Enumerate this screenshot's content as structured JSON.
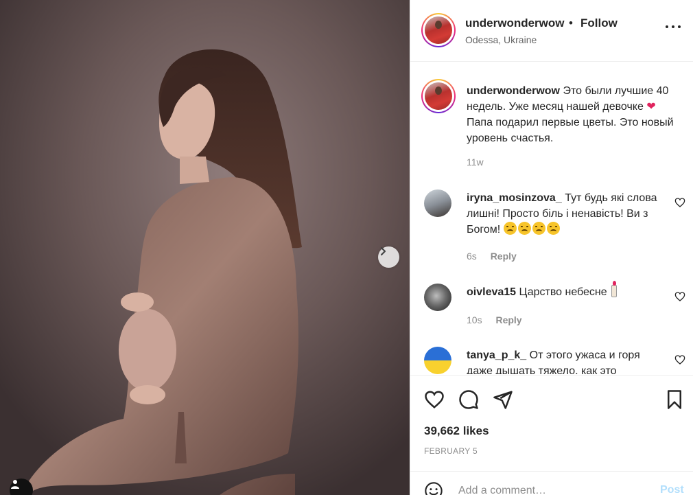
{
  "post": {
    "username": "underwonderwow",
    "separator": "•",
    "follow_label": "Follow",
    "location": "Odessa, Ukraine",
    "caption_line": "Это были лучшие 40 недель. Уже месяц нашей девочке",
    "caption_line2": "Папа подарил первые цветы. Это новый уровень счастья.",
    "caption_time": "11w",
    "likes": "39,662 likes",
    "date": "FEBRUARY 5"
  },
  "comments": [
    {
      "username": "iryna_mosinzova_",
      "text": "Тут будь які слова лишні! Просто біль і ненавість! Ви з Богом!",
      "time": "6s",
      "reply_label": "Reply"
    },
    {
      "username": "oivleva15",
      "text": "Царство небесне",
      "time": "10s",
      "reply_label": "Reply"
    },
    {
      "username": "tanya_p_k_",
      "text": "От этого ужаса и горя даже дышать тяжело, как это"
    }
  ],
  "add_comment": {
    "placeholder": "Add a comment…",
    "post_label": "Post"
  },
  "colors": {
    "accent_disabled": "#b2dffc",
    "heart": "#e0245e",
    "muted": "#8e8e8e",
    "text": "#262626"
  },
  "icons": {
    "next": "chevron-right-icon",
    "more": "more-horizontal-icon",
    "like": "heart-icon",
    "comment": "comment-bubble-icon",
    "share": "paper-plane-icon",
    "save": "bookmark-icon",
    "emoji": "smiley-icon",
    "tag": "user-tag-icon"
  }
}
